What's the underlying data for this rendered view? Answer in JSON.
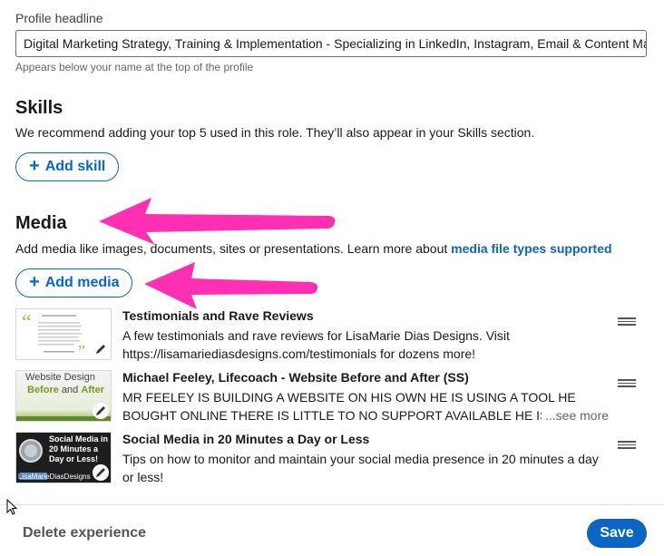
{
  "headline": {
    "label": "Profile headline",
    "value": "Digital Marketing Strategy, Training & Implementation - Specializing in LinkedIn, Instagram, Email & Content Marketing",
    "helper": "Appears below your name at the top of the profile"
  },
  "skills": {
    "title": "Skills",
    "description": "We recommend adding your top 5 used in this role. They’ll also appear in your Skills section.",
    "add_label": "Add skill"
  },
  "media": {
    "title": "Media",
    "description_prefix": "Add media like images, documents, sites or presentations. Learn more about ",
    "description_link": "media file types supported",
    "add_label": "Add media",
    "items": [
      {
        "title": "Testimonials and Rave Reviews",
        "description": "A few testimonials and rave reviews for LisaMarie Dias Designs. Visit https://lisamariediasdesigns.com/testimonials for dozens more!",
        "thumb_icon": "testimonial-thumbnail"
      },
      {
        "title": "Michael Feeley, Lifecoach - Website Before and After (SS)",
        "description": "MR FEELEY IS BUILDING A WEBSITE ON HIS OWN HE IS USING A TOOL HE BOUGHT ONLINE THERE IS LITTLE TO NO SUPPORT AVAILABLE HE IS FRUSTRATED WITH",
        "see_more": "...see more",
        "thumb_text_1": "Website Design",
        "thumb_text_2a": "Before",
        "thumb_text_2b": " and ",
        "thumb_text_2c": "After"
      },
      {
        "title": "Social Media in 20 Minutes a Day or Less",
        "description": "Tips on how to monitor and maintain your social media presence in 20 minutes a day or less!",
        "thumb_text": "Social Media in 20 Minutes a Day or Less!",
        "thumb_brand": "LisaMarieDiasDesigns"
      }
    ]
  },
  "footer": {
    "delete_label": "Delete experience",
    "save_label": "Save"
  },
  "colors": {
    "accent": "#0a66c2",
    "annotation_arrow": "#ff2fb3"
  }
}
